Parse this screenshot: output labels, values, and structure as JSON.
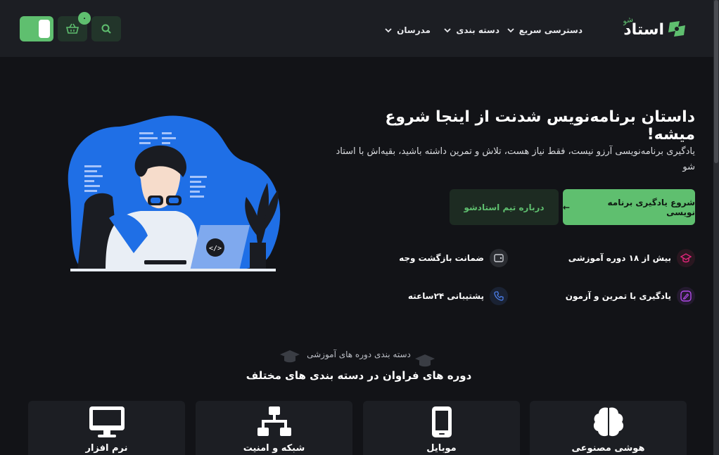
{
  "header": {
    "logo_text": "استاد",
    "logo_sub": "شو",
    "nav": [
      {
        "label": "دسترسی سریع"
      },
      {
        "label": "دسته بندی"
      },
      {
        "label": "مدرسان"
      }
    ],
    "cart_count": "۰",
    "icons": {
      "search": "search-icon",
      "cart": "basket-icon",
      "chevron": "chevron-down-icon"
    }
  },
  "hero": {
    "title": "داستان برنامه‌نویس شدنت از اینجا شروع میشه!",
    "description": "یادگیری برنامه‌نویسی آرزو نیست، فقط نیاز هست، تلاش و تمرین داشته باشید، بقیه‌اش با استاد شو",
    "primary_button": "شروع یادگیری برنامه نویسی",
    "primary_arrow": "←",
    "secondary_button": "درباره تیم استادشو",
    "code_badge": "</>",
    "features": [
      {
        "label": "بیش از ۱۸ دوره آموزشی",
        "icon": "graduation-cap-icon",
        "color": "#e0257a"
      },
      {
        "label": "ضمانت بازگشت وجه",
        "icon": "wallet-icon",
        "color": "#c9ccd2"
      },
      {
        "label": "یادگیری با تمرین و آزمون",
        "icon": "pencil-icon",
        "color": "#b04ae8"
      },
      {
        "label": "پشتیبانی ۲۴ساعته",
        "icon": "phone-icon",
        "color": "#4a7de8"
      }
    ]
  },
  "categories": {
    "subtitle": "دسته بندی دوره های آموزشی",
    "title": "دوره های فراوان در دسته بندی های مختلف",
    "items": [
      {
        "label": "هوشی مصنوعی",
        "icon": "brain-icon"
      },
      {
        "label": "موبایل",
        "icon": "mobile-icon"
      },
      {
        "label": "شبکه و امنیت",
        "icon": "network-icon"
      },
      {
        "label": "نرم افزار",
        "icon": "monitor-icon"
      }
    ]
  },
  "colors": {
    "accent": "#5fbf6f",
    "background": "#121317",
    "header": "#1c1e23",
    "illustration_blue": "#1f6fe6"
  }
}
